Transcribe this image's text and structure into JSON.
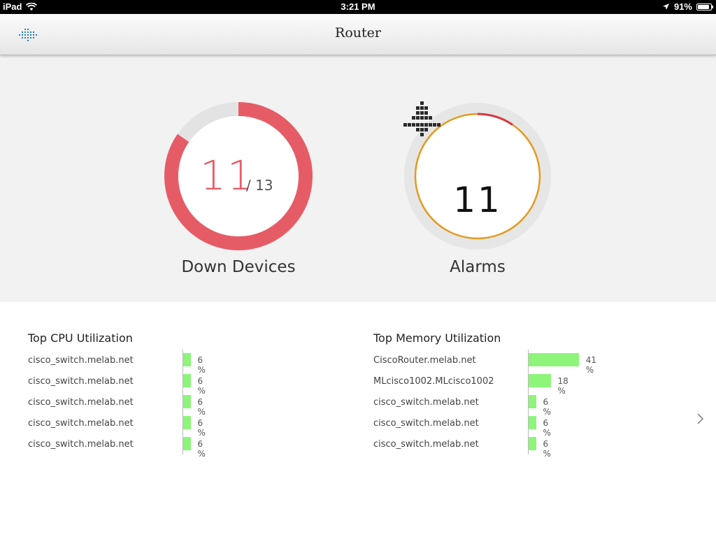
{
  "status_bar": {
    "device": "iPad",
    "time": "3:21 PM",
    "battery": "91%",
    "battery_level": 0.91
  },
  "nav": {
    "title": "Router",
    "menu_icon": "grid-menu-icon"
  },
  "down_devices": {
    "count": "11",
    "total": "/ 13",
    "fraction": 0.846,
    "label": "Down Devices",
    "color": "#e65c66"
  },
  "alarms": {
    "count": "11",
    "label": "Alarms",
    "icon": "alarm-tree-icon",
    "ring_color": "#e39b1e",
    "critical_color": "#d9363e"
  },
  "cpu": {
    "title": "Top CPU Utilization",
    "rows": [
      {
        "name": "cisco_switch.melab.net",
        "pct": "6 %",
        "value": 6
      },
      {
        "name": "cisco_switch.melab.net",
        "pct": "6 %",
        "value": 6
      },
      {
        "name": "cisco_switch.melab.net",
        "pct": "6 %",
        "value": 6
      },
      {
        "name": "cisco_switch.melab.net",
        "pct": "6 %",
        "value": 6
      },
      {
        "name": "cisco_switch.melab.net",
        "pct": "6 %",
        "value": 6
      }
    ]
  },
  "memory": {
    "title": "Top Memory Utilization",
    "rows": [
      {
        "name": "CiscoRouter.melab.net",
        "pct": "41 %",
        "value": 41
      },
      {
        "name": "MLcisco1002.MLcisco1002",
        "pct": "18 %",
        "value": 18
      },
      {
        "name": "cisco_switch.melab.net",
        "pct": "6 %",
        "value": 6
      },
      {
        "name": "cisco_switch.melab.net",
        "pct": "6 %",
        "value": 6
      },
      {
        "name": "cisco_switch.melab.net",
        "pct": "6 %",
        "value": 6
      }
    ]
  },
  "bar_color": "#8cf57a",
  "next_icon": "chevron-right-icon"
}
